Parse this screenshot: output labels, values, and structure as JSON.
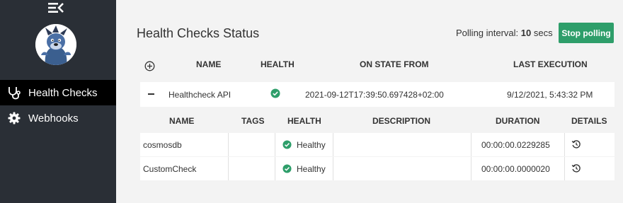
{
  "sidebar": {
    "items": [
      {
        "label": "Health Checks",
        "icon": "stethoscope-icon",
        "active": true
      },
      {
        "label": "Webhooks",
        "icon": "gear-icon",
        "active": false
      }
    ]
  },
  "header": {
    "title": "Health Checks Status",
    "polling_prefix": "Polling interval: ",
    "polling_value": "10",
    "polling_suffix": " secs",
    "stop_button": "Stop polling"
  },
  "table": {
    "columns": [
      "NAME",
      "HEALTH",
      "ON STATE FROM",
      "LAST EXECUTION"
    ],
    "rows": [
      {
        "name": "Healthcheck API",
        "health": "healthy",
        "on_state_from": "2021-09-12T17:39:50.697428+02:00",
        "last_execution": "9/12/2021, 5:43:32 PM"
      }
    ]
  },
  "entries": {
    "columns": [
      "NAME",
      "TAGS",
      "HEALTH",
      "DESCRIPTION",
      "DURATION",
      "DETAILS"
    ],
    "rows": [
      {
        "name": "cosmosdb",
        "tags": "",
        "health": "Healthy",
        "description": "",
        "duration": "00:00:00.0229285"
      },
      {
        "name": "CustomCheck",
        "tags": "",
        "health": "Healthy",
        "description": "",
        "duration": "00:00:00.0000020"
      }
    ]
  },
  "colors": {
    "sidebar_bg": "#2a2f36",
    "accent_green": "#2e9e6a",
    "page_bg": "#f3f3f3"
  }
}
